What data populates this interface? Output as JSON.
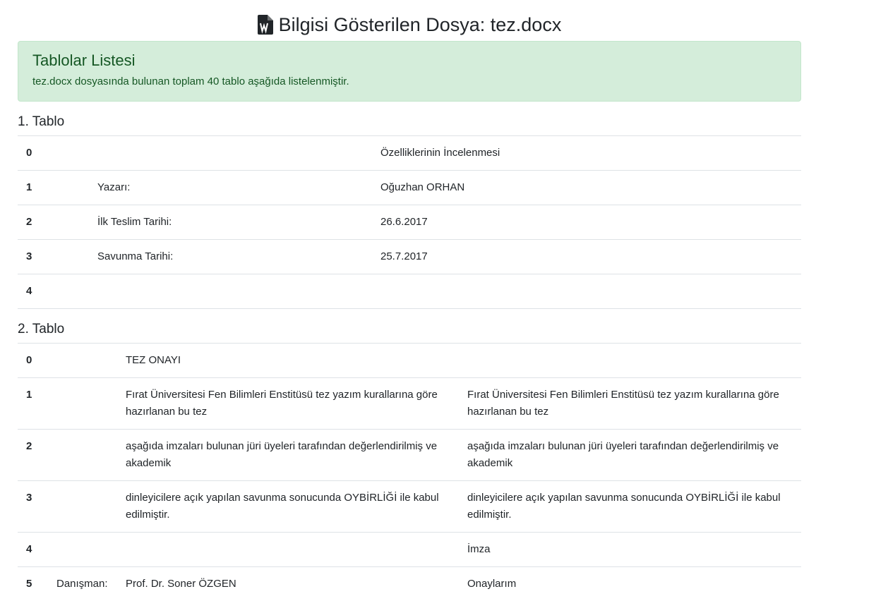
{
  "header": {
    "title": "Bilgisi Gösterilen Dosya: tez.docx",
    "icon": "word-file-icon"
  },
  "alert": {
    "heading": "Tablolar Listesi",
    "text": "tez.docx dosyasında bulunan toplam 40 tablo aşağıda listelenmiştir.",
    "bg_color": "#d4edda",
    "text_color": "#155724"
  },
  "tables": [
    {
      "title": "1. Tablo",
      "rows": [
        {
          "idx": "0",
          "c1": "",
          "c2": "Özelliklerinin İncelenmesi"
        },
        {
          "idx": "1",
          "c1": "Yazarı:",
          "c2": "Oğuzhan ORHAN"
        },
        {
          "idx": "2",
          "c1": "İlk Teslim Tarihi:",
          "c2": "26.6.2017"
        },
        {
          "idx": "3",
          "c1": "Savunma Tarihi:",
          "c2": "25.7.2017"
        },
        {
          "idx": "4",
          "c1": "",
          "c2": ""
        }
      ]
    },
    {
      "title": "2. Tablo",
      "rows": [
        {
          "idx": "0",
          "c1": "",
          "c2": "TEZ ONAYI",
          "c3": ""
        },
        {
          "idx": "1",
          "c1": "",
          "c2": "Fırat Üniversitesi Fen Bilimleri Enstitüsü tez yazım kurallarına göre hazırlanan bu tez",
          "c3": "Fırat Üniversitesi Fen Bilimleri Enstitüsü tez yazım kurallarına göre hazırlanan bu tez"
        },
        {
          "idx": "2",
          "c1": "",
          "c2": "aşağıda imzaları bulunan jüri üyeleri tarafından değerlendirilmiş ve akademik",
          "c3": "aşağıda imzaları bulunan jüri üyeleri tarafından değerlendirilmiş ve akademik"
        },
        {
          "idx": "3",
          "c1": "",
          "c2": "dinleyicilere açık yapılan savunma sonucunda OYBİRLİĞİ ile kabul edilmiştir.",
          "c3": "dinleyicilere açık yapılan savunma sonucunda OYBİRLİĞİ ile kabul edilmiştir."
        },
        {
          "idx": "4",
          "c1": "",
          "c2": "",
          "c3": "İmza"
        },
        {
          "idx": "5",
          "c1": "Danışman:",
          "c2": "Prof. Dr. Soner ÖZGEN",
          "c3": "Onaylarım"
        }
      ]
    }
  ]
}
